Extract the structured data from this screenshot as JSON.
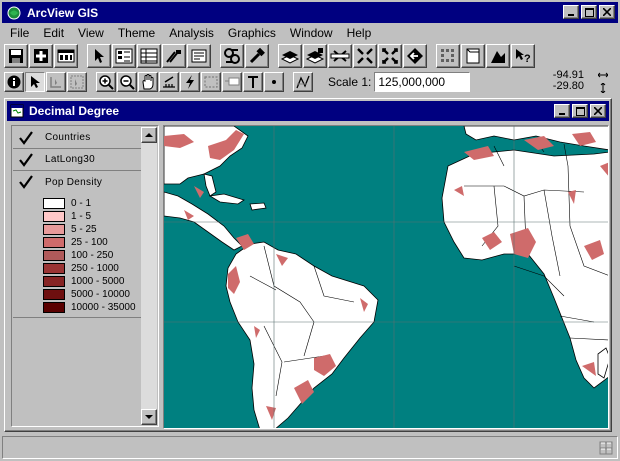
{
  "app": {
    "title": "ArcView GIS"
  },
  "menu": [
    "File",
    "Edit",
    "View",
    "Theme",
    "Analysis",
    "Graphics",
    "Window",
    "Help"
  ],
  "toolbar": {
    "buttons": [
      "save-icon",
      "add-theme-icon",
      "theme-properties-icon",
      "edit-legend-icon",
      "open-theme-table-icon",
      "find-icon",
      "locate-address-icon",
      "query-builder-icon",
      "zoom-to-full-extent-icon",
      "zoom-to-active-themes-icon",
      "zoom-to-selected-icon",
      "zoom-in-fixed-icon",
      "zoom-out-fixed-icon",
      "zoom-previous-icon",
      "select-features-icon",
      "clear-selected-icon",
      "help-icon"
    ],
    "tools": [
      "identify-icon",
      "pointer-icon",
      "vertex-edit-icon",
      "select-feature-tool-icon",
      "zoom-in-icon",
      "zoom-out-icon",
      "pan-icon",
      "measure-icon",
      "hotlink-icon",
      "area-of-interest-icon",
      "label-icon",
      "text-icon",
      "draw-point-icon",
      "snap-icon"
    ]
  },
  "scale": {
    "label": "Scale 1:",
    "value": "125,000,000"
  },
  "coords": {
    "x": "-94.91",
    "y": "-29.80"
  },
  "view": {
    "title": "Decimal Degree",
    "layers": [
      {
        "name": "Countries",
        "checked": true
      },
      {
        "name": "LatLong30",
        "checked": true
      },
      {
        "name": "Pop Density",
        "checked": true
      }
    ],
    "legend": [
      {
        "label": "0 - 1",
        "color": "#ffffff"
      },
      {
        "label": "1 - 5",
        "color": "#ffc8c8"
      },
      {
        "label": "5 - 25",
        "color": "#e89a9a"
      },
      {
        "label": "25 - 100",
        "color": "#cf6b6b"
      },
      {
        "label": "100 - 250",
        "color": "#b05a5a"
      },
      {
        "label": "250 - 1000",
        "color": "#9a3434"
      },
      {
        "label": "1000 - 5000",
        "color": "#862424"
      },
      {
        "label": "5000 - 10000",
        "color": "#6e0f0f"
      },
      {
        "label": "10000 - 35000",
        "color": "#5a0000"
      }
    ]
  },
  "colors": {
    "title_bar": "#000080",
    "ocean": "#008080",
    "land": "#ffffff",
    "graticule": "#5a7070",
    "population": "#cf6b6b"
  }
}
